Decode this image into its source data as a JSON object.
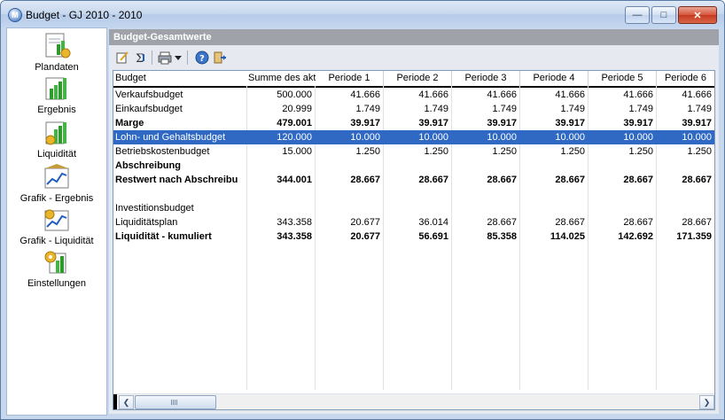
{
  "window": {
    "title": "Budget - GJ 2010 - 2010",
    "app_icon_letter": "M"
  },
  "sidebar": {
    "items": [
      {
        "label": "Plandaten",
        "icon": "document-chart-icon"
      },
      {
        "label": "Ergebnis",
        "icon": "bar-chart-icon"
      },
      {
        "label": "Liquidität",
        "icon": "bar-chart-coins-icon"
      },
      {
        "label": "Grafik - Ergebnis",
        "icon": "line-graph-icon"
      },
      {
        "label": "Grafik - Liquidität",
        "icon": "graph-coins-icon"
      },
      {
        "label": "Einstellungen",
        "icon": "settings-chart-icon"
      }
    ]
  },
  "panel": {
    "title": "Budget-Gesamtwerte"
  },
  "toolbar": {
    "buttons": [
      "edit-icon",
      "recalc-icon",
      "print-icon",
      "dropdown-icon",
      "help-icon",
      "exit-icon"
    ]
  },
  "grid": {
    "columns": [
      "Budget",
      "Summe des aktu",
      "Periode 1",
      "Periode 2",
      "Periode 3",
      "Periode 4",
      "Periode 5",
      "Periode 6"
    ],
    "rows": [
      {
        "name": "Verkaufsbudget",
        "values": [
          "500.000",
          "41.666",
          "41.666",
          "41.666",
          "41.666",
          "41.666",
          "41.666"
        ],
        "bold": false,
        "selected": false
      },
      {
        "name": "Einkaufsbudget",
        "values": [
          "20.999",
          "1.749",
          "1.749",
          "1.749",
          "1.749",
          "1.749",
          "1.749"
        ],
        "bold": false,
        "selected": false
      },
      {
        "name": "Marge",
        "values": [
          "479.001",
          "39.917",
          "39.917",
          "39.917",
          "39.917",
          "39.917",
          "39.917"
        ],
        "bold": true,
        "selected": false
      },
      {
        "name": "Lohn- und Gehaltsbudget",
        "values": [
          "120.000",
          "10.000",
          "10.000",
          "10.000",
          "10.000",
          "10.000",
          "10.000"
        ],
        "bold": false,
        "selected": true
      },
      {
        "name": "Betriebskostenbudget",
        "values": [
          "15.000",
          "1.250",
          "1.250",
          "1.250",
          "1.250",
          "1.250",
          "1.250"
        ],
        "bold": false,
        "selected": false
      },
      {
        "name": "Abschreibung",
        "values": [
          "",
          "",
          "",
          "",
          "",
          "",
          ""
        ],
        "bold": true,
        "selected": false
      },
      {
        "name": "Restwert nach Abschreibu",
        "values": [
          "344.001",
          "28.667",
          "28.667",
          "28.667",
          "28.667",
          "28.667",
          "28.667"
        ],
        "bold": true,
        "selected": false
      },
      {
        "name": "",
        "values": [
          "",
          "",
          "",
          "",
          "",
          "",
          ""
        ],
        "bold": false,
        "selected": false
      },
      {
        "name": "Investitionsbudget",
        "values": [
          "",
          "",
          "",
          "",
          "",
          "",
          ""
        ],
        "bold": false,
        "selected": false
      },
      {
        "name": "Liquiditätsplan",
        "values": [
          "343.358",
          "20.677",
          "36.014",
          "28.667",
          "28.667",
          "28.667",
          "28.667"
        ],
        "bold": false,
        "selected": false
      },
      {
        "name": "Liquidität - kumuliert",
        "values": [
          "343.358",
          "20.677",
          "56.691",
          "85.358",
          "114.025",
          "142.692",
          "171.359"
        ],
        "bold": true,
        "selected": false
      }
    ]
  },
  "colors": {
    "selection": "#2f69c4",
    "panel_header": "#9fa3a9",
    "window_bg": "#c7d7ec"
  }
}
